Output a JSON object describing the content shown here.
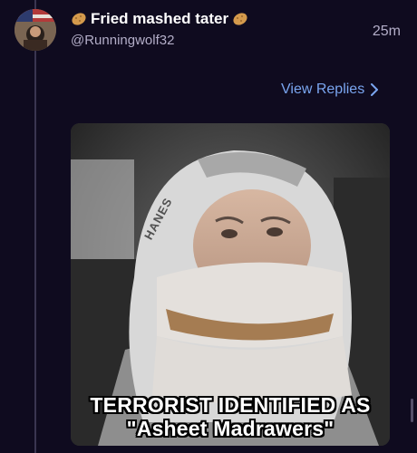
{
  "post": {
    "display_name": "Fried mashed tater",
    "name_icon": "potato-icon",
    "handle": "@Runningwolf32",
    "timestamp": "25m"
  },
  "actions": {
    "view_replies_label": "View Replies",
    "view_replies_icon": "chevron-right-icon"
  },
  "media": {
    "description_icon": "meme-image",
    "brand_text": "HANES",
    "caption_line1": "TERRORIST IDENTIFIED AS",
    "caption_line2": "\"Asheet Madrawers\""
  },
  "colors": {
    "background": "#0f0b1f",
    "accent_link": "#7aa6f0",
    "muted_text": "#b3aec8",
    "thread_line": "#3a3550"
  }
}
